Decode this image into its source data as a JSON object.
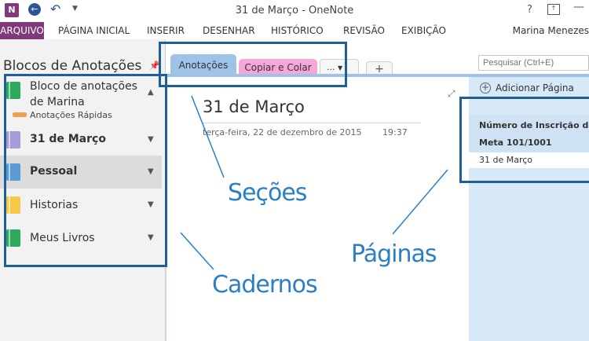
{
  "window": {
    "title": "31 de Março - OneNote",
    "app_icon": "N",
    "help": "?"
  },
  "ribbon": {
    "tabs": [
      "ARQUIVO",
      "PÁGINA INICIAL",
      "INSERIR",
      "DESENHAR",
      "HISTÓRICO",
      "REVISÃO",
      "EXIBIÇÃO"
    ],
    "user": "Marina Menezes"
  },
  "notebooks": {
    "pane_title": "Blocos de Anotações",
    "current": {
      "label": "Bloco de anotações de Marina",
      "color": "#2eaa5c"
    },
    "quick_notes": "Anotações Rápidas",
    "items": [
      {
        "label": "31 de Março",
        "color": "#a99bd6",
        "bold": true
      },
      {
        "label": "Pessoal",
        "color": "#5a9bd5",
        "bold": true,
        "selected": true
      },
      {
        "label": "Historias",
        "color": "#f6c94a",
        "bold": false
      },
      {
        "label": "Meus Livros",
        "color": "#2eaa5c",
        "bold": false
      }
    ]
  },
  "sections": {
    "tabs": [
      {
        "label": "Anotações",
        "color": "#9ec3e6"
      },
      {
        "label": "Copiar e Colar",
        "color": "#f7a6d8"
      }
    ],
    "more": "...",
    "add": "+"
  },
  "page": {
    "title": "31 de Março",
    "date": "terça-feira, 22 de dezembro de 2015",
    "time": "19:37"
  },
  "pages_pane": {
    "search_placeholder": "Pesquisar (Ctrl+E)",
    "add_page": "Adicionar Página",
    "items": [
      "Número de Inscrição do EN",
      "Meta 101/1001",
      "31 de Março"
    ]
  },
  "annotations": {
    "sections": "Seções",
    "notebooks": "Cadernos",
    "pages": "Páginas"
  }
}
